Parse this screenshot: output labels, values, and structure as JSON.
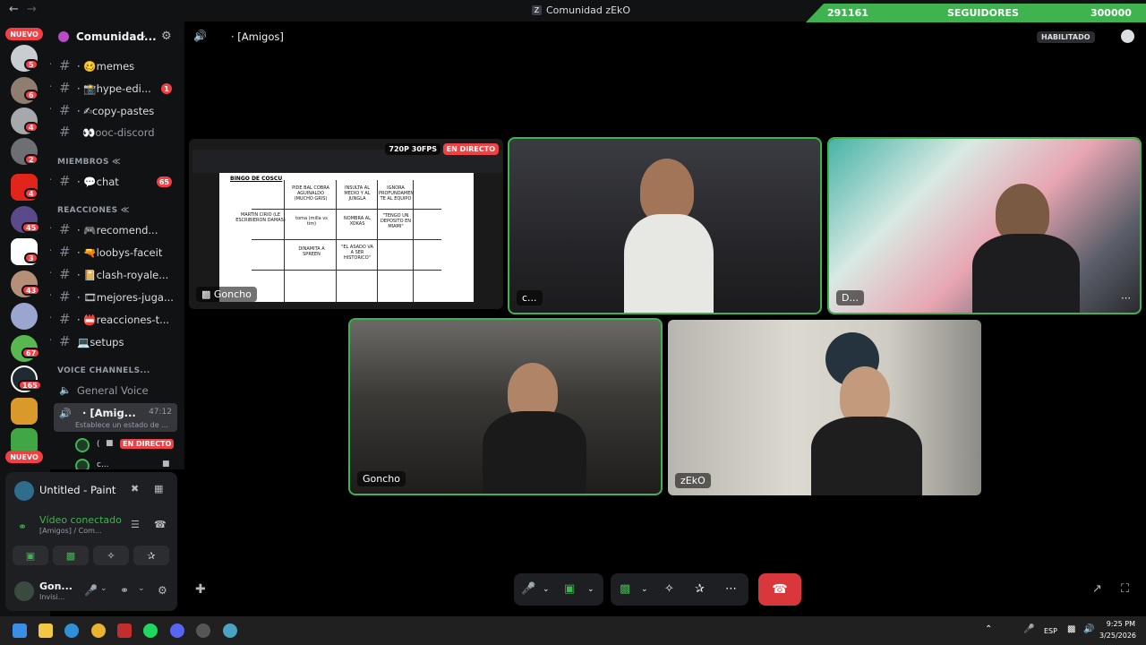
{
  "window": {
    "title": "Comunidad zEkO"
  },
  "follow_goal": {
    "current": "291161",
    "label": "SEGUIDORES",
    "target": "300000"
  },
  "guild_bar": {
    "nuevo_top": "NUEVO",
    "nuevo_bottom": "NUEVO",
    "badges": [
      "5",
      "6",
      "4",
      "2",
      "4",
      "45",
      "3",
      "43",
      "67",
      "165"
    ]
  },
  "server": {
    "name": "Comunidad..."
  },
  "channels": [
    {
      "name": "· 🥴memes",
      "count": ""
    },
    {
      "name": "· 📸hype-edi...",
      "count": "1"
    },
    {
      "name": "· ✍copy-pastes",
      "count": ""
    },
    {
      "name": "👀ooc-discord",
      "count": ""
    },
    {
      "name": "· 💬chat",
      "count": "65"
    },
    {
      "name": "· 🎮recomend...",
      "count": ""
    },
    {
      "name": "· 🔫loobys-faceit",
      "count": ""
    },
    {
      "name": "· 📔clash-royale...",
      "count": ""
    },
    {
      "name": "· 🎞mejores-juga...",
      "count": ""
    },
    {
      "name": "· 📛reacciones-t...",
      "count": ""
    },
    {
      "name": "💻setups",
      "count": ""
    }
  ],
  "categories": {
    "miembros": "MIEMBROS ≪",
    "reacciones": "REACCIONES ≪",
    "voice": "VOICE CHANNELS..."
  },
  "voice_channels": {
    "general": "General Voice",
    "active_name": "· [Amig...",
    "active_time": "47:12",
    "active_status": "Establece un estado de ...",
    "users": [
      {
        "name": "(",
        "live": "EN DIRECTO"
      },
      {
        "name": "c...",
        "live": ""
      }
    ]
  },
  "activity": {
    "name": "Untitled - Paint"
  },
  "connection": {
    "status": "Vídeo conectado",
    "channel": "[Amigos] / Com..."
  },
  "user": {
    "name": "Gon...",
    "status": "Invisi..."
  },
  "header": {
    "channel": "· [Amigos]",
    "badge": "HABILITADO"
  },
  "stream": {
    "quality": "720P 30FPS",
    "live": "EN DIRECTO",
    "owner": "Goncho",
    "bingo_title": "BINGO DE COSCU",
    "cells": [
      "PIDE BAL COBRA AGUINALDO (MUCHO GRIS)",
      "INSULTA AL MEDIO Y AL JUNGLA",
      "IGNORA PROFUNDAMEN TE AL EQUIPO",
      "MARTIN CIRIO (LE ESCRIBIERON DAMAS)",
      "toma (milla vs tim)",
      "NOMBRA AL XOKAS",
      "\"TENGO UN DEPOSITO EN MIAMI\"",
      "DINAMITA A SPREEN",
      "\"EL ASADO VA A SER HISTORICO\""
    ]
  },
  "tiles": {
    "t1": "c...",
    "t2": "D...",
    "t3": "Goncho",
    "t4": "zEkO"
  },
  "taskbar": {
    "lang": "ESP",
    "time": "9:25 PM",
    "date": "3/25/2026"
  },
  "colors": {
    "accent": "#3fb34f",
    "live": "#ed4245",
    "hangup": "#da373c"
  }
}
